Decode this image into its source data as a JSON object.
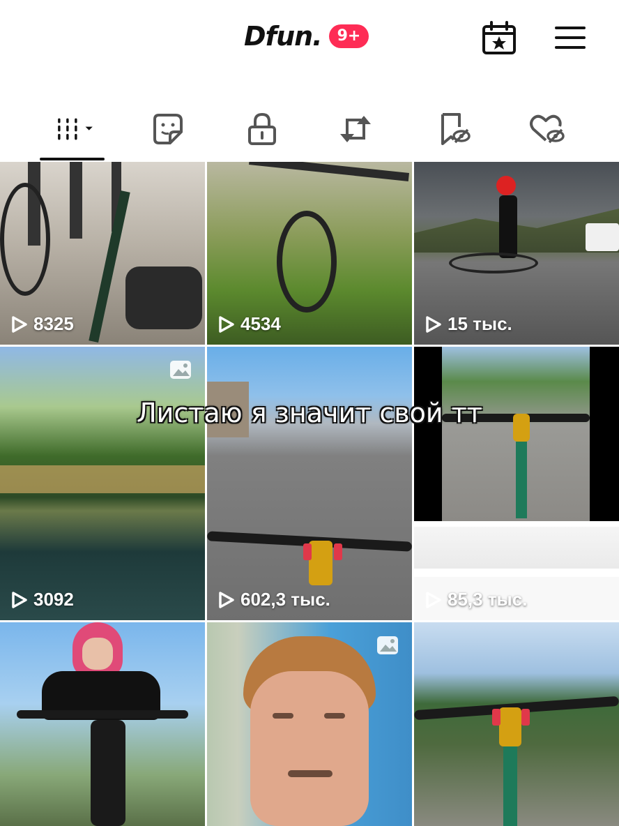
{
  "header": {
    "logo_text": "Dfun.",
    "badge": "9+",
    "calendar_icon": "calendar-star-icon",
    "menu_icon": "hamburger-menu-icon"
  },
  "tabs": [
    {
      "name": "videos",
      "icon": "grid-bars-dropdown-icon",
      "active": true
    },
    {
      "name": "stickers",
      "icon": "sticker-icon"
    },
    {
      "name": "private",
      "icon": "lock-icon"
    },
    {
      "name": "reposts",
      "icon": "repost-icon"
    },
    {
      "name": "saved",
      "icon": "bookmark-hidden-icon"
    },
    {
      "name": "liked",
      "icon": "heart-hidden-icon"
    }
  ],
  "overlay_caption": "Листаю я значит свой тт",
  "videos": [
    {
      "views": "8325"
    },
    {
      "views": "4534"
    },
    {
      "views": "15 тыс."
    },
    {
      "views": "3092",
      "photo": true
    },
    {
      "views": "602,3 тыс."
    },
    {
      "views": "85,3 тыс."
    },
    {
      "views": ""
    },
    {
      "views": "",
      "photo": true
    },
    {
      "views": ""
    }
  ],
  "colors": {
    "accent": "#fe2c55",
    "text": "#111111"
  }
}
